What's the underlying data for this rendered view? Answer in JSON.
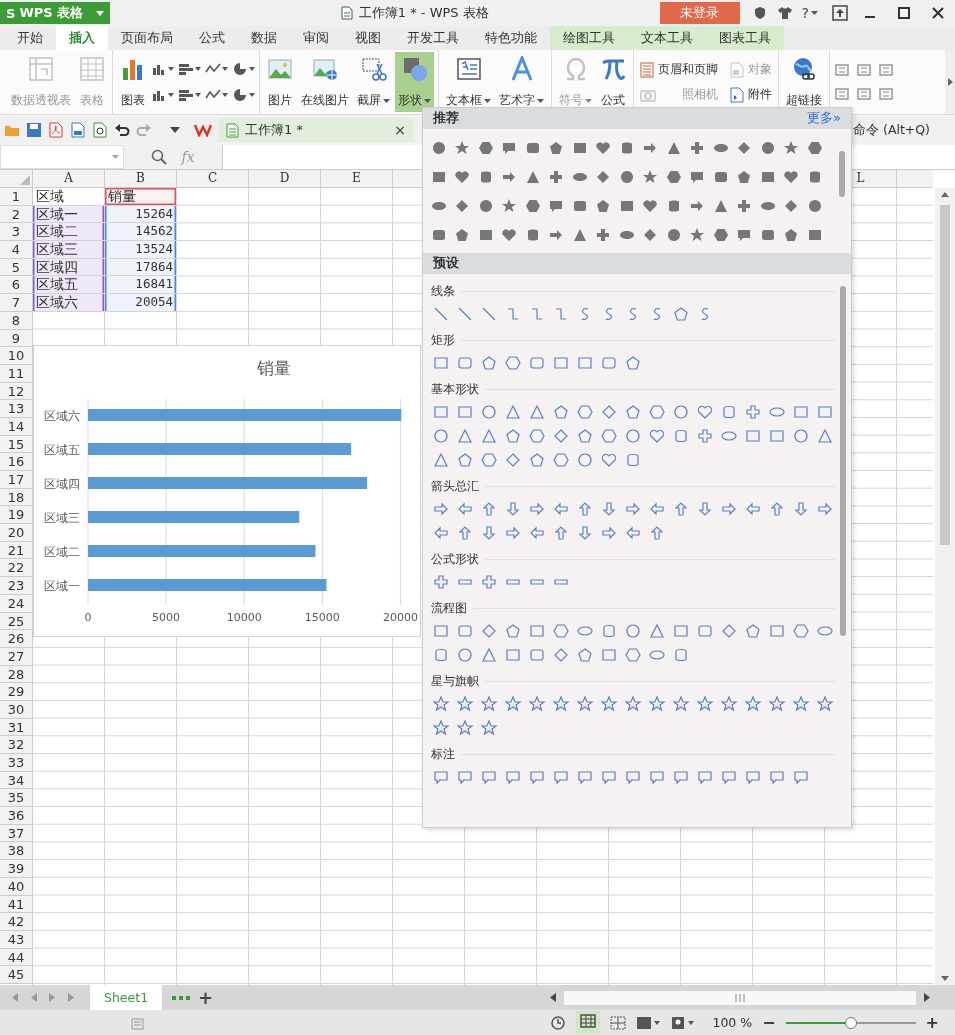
{
  "title_bar": {
    "app_logo": "S",
    "app_name": "WPS 表格",
    "title": "工作簿1 * - WPS 表格",
    "login": "未登录",
    "help": "?"
  },
  "tabs": [
    {
      "label": "开始",
      "selected": false,
      "kind": "main"
    },
    {
      "label": "插入",
      "selected": true,
      "kind": "main"
    },
    {
      "label": "页面布局",
      "selected": false,
      "kind": "main"
    },
    {
      "label": "公式",
      "selected": false,
      "kind": "main"
    },
    {
      "label": "数据",
      "selected": false,
      "kind": "main"
    },
    {
      "label": "审阅",
      "selected": false,
      "kind": "main"
    },
    {
      "label": "视图",
      "selected": false,
      "kind": "main"
    },
    {
      "label": "开发工具",
      "selected": false,
      "kind": "main"
    },
    {
      "label": "特色功能",
      "selected": false,
      "kind": "main"
    },
    {
      "label": "绘图工具",
      "selected": false,
      "kind": "context"
    },
    {
      "label": "文本工具",
      "selected": false,
      "kind": "context"
    },
    {
      "label": "图表工具",
      "selected": false,
      "kind": "context"
    }
  ],
  "ribbon": [
    {
      "kind": "large",
      "buttons": [
        {
          "kind": "pivot",
          "label": "数据透视表",
          "disabled": true,
          "dropdown": false,
          "pressed": false
        },
        {
          "kind": "table",
          "label": "表格",
          "disabled": true,
          "dropdown": false,
          "pressed": false
        }
      ]
    },
    {
      "kind": "charts",
      "buttons": [
        {
          "kind": "chart",
          "label": "图表",
          "disabled": false,
          "dropdown": false,
          "pressed": false
        }
      ]
    },
    {
      "kind": "large",
      "buttons": [
        {
          "kind": "picture",
          "label": "图片",
          "disabled": false,
          "dropdown": false,
          "pressed": false
        },
        {
          "kind": "online-picture",
          "label": "在线图片",
          "disabled": false,
          "dropdown": false,
          "pressed": false
        },
        {
          "kind": "screenshot",
          "label": "截屏",
          "disabled": false,
          "dropdown": true,
          "pressed": false
        },
        {
          "kind": "shape",
          "label": "形状",
          "disabled": false,
          "dropdown": true,
          "pressed": true
        }
      ]
    },
    {
      "kind": "large",
      "buttons": [
        {
          "kind": "textbox",
          "label": "文本框",
          "disabled": false,
          "dropdown": true,
          "pressed": false
        },
        {
          "kind": "wordart",
          "label": "艺术字",
          "disabled": false,
          "dropdown": true,
          "pressed": false
        }
      ]
    },
    {
      "kind": "large",
      "buttons": [
        {
          "kind": "symbol",
          "label": "符号",
          "disabled": true,
          "dropdown": true,
          "pressed": false
        },
        {
          "kind": "formula",
          "label": "公式",
          "disabled": false,
          "dropdown": false,
          "pressed": false
        }
      ]
    },
    {
      "kind": "small",
      "buttons": [
        {
          "kind": "header",
          "label": "页眉和页脚",
          "disabled": false
        },
        {
          "kind": "object",
          "label": "对象",
          "disabled": true
        },
        {
          "kind": "camera",
          "label": "照相机",
          "disabled": true
        },
        {
          "kind": "attachment",
          "label": "附件",
          "disabled": false
        }
      ]
    },
    {
      "kind": "large",
      "buttons": [
        {
          "kind": "hyperlink",
          "label": "超链接",
          "disabled": false,
          "dropdown": false,
          "pressed": false
        }
      ]
    }
  ],
  "quick_bar": {
    "doc_tab": "工作簿1 *",
    "close": "×",
    "command_search": "命令 (Alt+Q)"
  },
  "formula_bar": {
    "fx": "fx"
  },
  "sheet": {
    "column_headers": [
      "A",
      "B",
      "C",
      "D",
      "E",
      "L"
    ],
    "row_numbers": [
      "1",
      "2",
      "3",
      "4",
      "5",
      "6",
      "7",
      "8",
      "9",
      "10",
      "11",
      "12",
      "13",
      "14",
      "15",
      "16",
      "17",
      "18",
      "19",
      "20",
      "21",
      "22",
      "23",
      "24",
      "25",
      "26",
      "27",
      "28",
      "29",
      "30",
      "31",
      "32",
      "33",
      "34",
      "35",
      "36",
      "37",
      "38",
      "39",
      "40",
      "41",
      "42",
      "43",
      "44",
      "45"
    ],
    "rows": [
      [
        {
          "text": "区域",
          "kind": "header"
        },
        {
          "text": "销量",
          "kind": "series"
        }
      ],
      [
        {
          "text": "区域一",
          "kind": "category"
        },
        {
          "text": "15264",
          "kind": "value"
        }
      ],
      [
        {
          "text": "区域二",
          "kind": "category"
        },
        {
          "text": "14562",
          "kind": "value"
        }
      ],
      [
        {
          "text": "区域三",
          "kind": "category"
        },
        {
          "text": "13524",
          "kind": "value"
        }
      ],
      [
        {
          "text": "区域四",
          "kind": "category"
        },
        {
          "text": "17864",
          "kind": "value"
        }
      ],
      [
        {
          "text": "区域五",
          "kind": "category"
        },
        {
          "text": "16841",
          "kind": "value"
        }
      ],
      [
        {
          "text": "区域六",
          "kind": "category"
        },
        {
          "text": "20054",
          "kind": "value"
        }
      ]
    ],
    "chart": {
      "chart_data": {
        "type": "bar",
        "orientation": "horizontal",
        "title": "销量",
        "categories": [
          "区域六",
          "区域五",
          "区域四",
          "区域三",
          "区域二",
          "区域一"
        ],
        "series": [
          {
            "color": "#5b9bd5",
            "values": [
              20054,
              16841,
              17864,
              13524,
              14562,
              15264
            ]
          }
        ],
        "xlim": [
          0,
          20100
        ],
        "xticks": [
          0,
          5000,
          10000,
          15000,
          20000
        ],
        "grid": true
      }
    }
  },
  "shapes_panel": {
    "recommended": "推荐",
    "more": "更多»",
    "presets": "预设",
    "sections": [
      "线条",
      "矩形",
      "基本形状",
      "箭头总汇",
      "公式形状",
      "流程图",
      "星与旗帜",
      "标注"
    ]
  },
  "sheet_tabs": [
    {
      "label": "Sheet1",
      "selected": true
    }
  ],
  "add_sheet": "+",
  "status_bar": {
    "zoom": "100 %",
    "zoom_out": "−",
    "zoom_in": "+",
    "level": 0.5
  }
}
